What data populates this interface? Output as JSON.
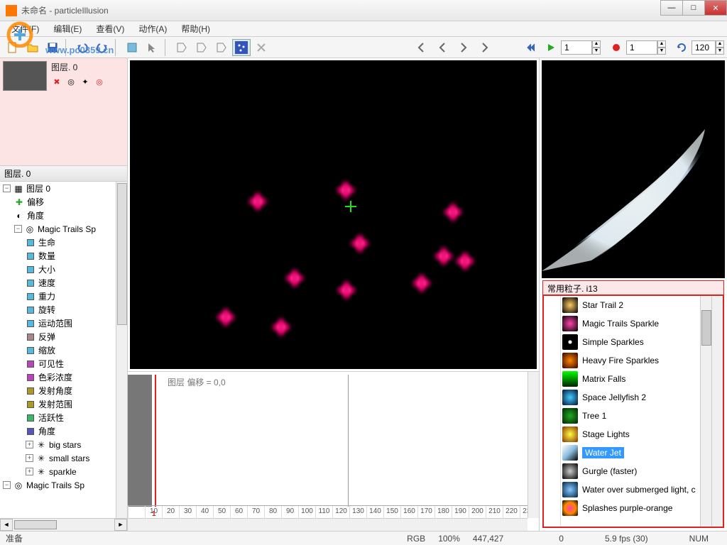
{
  "window": {
    "title": "未命名 - particleIllusion"
  },
  "menu": {
    "file": "文件(F)",
    "edit": "编辑(E)",
    "view": "查看(V)",
    "action": "动作(A)",
    "help": "帮助(H)"
  },
  "toolbar": {
    "frame_value": "1",
    "record_value": "1",
    "loop_value": "120"
  },
  "watermark_brand": "",
  "watermark_url": "www.pc0359.cn",
  "layer_panel": {
    "name": "图层. 0"
  },
  "layer_header": "图层. 0",
  "tree": {
    "root": "图层 0",
    "offset": "偏移",
    "angle": "角度",
    "emitter": "Magic Trails Sp",
    "props": [
      "生命",
      "数量",
      "大小",
      "速度",
      "重力",
      "旋转",
      "运动范围",
      "反弹",
      "缩放",
      "可见性",
      "色彩浓度",
      "发射角度",
      "发射范围",
      "活跃性",
      "角度"
    ],
    "sub_emitters": [
      "big stars",
      "small stars",
      "sparkle"
    ],
    "emitter2": "Magic Trails Sp"
  },
  "timeline": {
    "label": "图层 偏移 = 0,0",
    "marker": "1",
    "ticks": [
      "10",
      "20",
      "30",
      "40",
      "50",
      "60",
      "70",
      "80",
      "90",
      "100",
      "110",
      "120",
      "130",
      "140",
      "150",
      "160",
      "170",
      "180",
      "190",
      "200",
      "210",
      "220",
      "230",
      "2"
    ]
  },
  "library": {
    "header": "常用粒子. i13",
    "items": [
      {
        "label": "Star Trail 2",
        "thumb": "star"
      },
      {
        "label": "Magic Trails Sparkle",
        "thumb": "sparkle"
      },
      {
        "label": "Simple Sparkles",
        "thumb": "dots"
      },
      {
        "label": "Heavy Fire Sparkles",
        "thumb": "fire"
      },
      {
        "label": "Matrix Falls",
        "thumb": "matrix"
      },
      {
        "label": "Space Jellyfish 2",
        "thumb": "jelly"
      },
      {
        "label": "Tree 1",
        "thumb": "tree"
      },
      {
        "label": "Stage Lights",
        "thumb": "lights"
      },
      {
        "label": "Water Jet",
        "thumb": "water",
        "selected": true
      },
      {
        "label": "Gurgle (faster)",
        "thumb": "gurgle"
      },
      {
        "label": "Water over submerged light, c",
        "thumb": "sub"
      },
      {
        "label": "Splashes purple-orange",
        "thumb": "splash"
      }
    ]
  },
  "status": {
    "ready": "准备",
    "rgb": "RGB",
    "zoom": "100%",
    "coords": "447,427",
    "frame": "0",
    "fps": "5.9 fps (30)",
    "num": "NUM"
  },
  "prop_colors": [
    "#5bd",
    "#5bd",
    "#5bd",
    "#5bd",
    "#5bd",
    "#5bd",
    "#5bd",
    "#a88",
    "#5bd",
    "#b4b",
    "#b4b",
    "#a92",
    "#a92",
    "#3b6",
    "#55b"
  ]
}
